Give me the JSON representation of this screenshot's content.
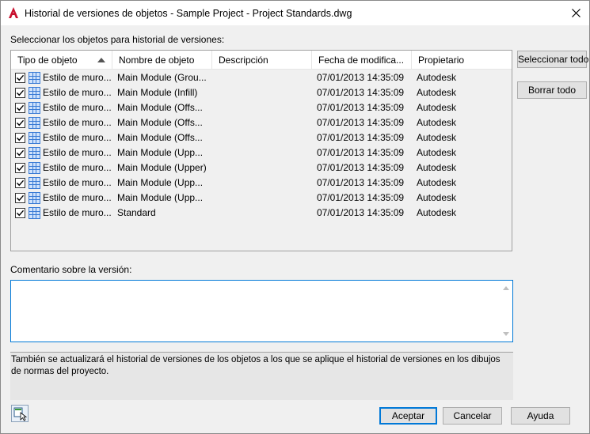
{
  "window": {
    "title": "Historial de versiones de objetos - Sample Project - Project Standards.dwg",
    "close_glyph": "✕"
  },
  "select_label": "Seleccionar los objetos para historial de versiones:",
  "columns": [
    "Tipo de objeto",
    "Nombre de objeto",
    "Descripción",
    "Fecha de modifica...",
    "Propietario"
  ],
  "rows": [
    {
      "checked": true,
      "type": "Estilo de muro...",
      "name": "Main Module (Grou...",
      "description": "",
      "date": "07/01/2013 14:35:09",
      "owner": "Autodesk"
    },
    {
      "checked": true,
      "type": "Estilo de muro...",
      "name": "Main Module (Infill)",
      "description": "",
      "date": "07/01/2013 14:35:09",
      "owner": "Autodesk"
    },
    {
      "checked": true,
      "type": "Estilo de muro...",
      "name": "Main Module (Offs...",
      "description": "",
      "date": "07/01/2013 14:35:09",
      "owner": "Autodesk"
    },
    {
      "checked": true,
      "type": "Estilo de muro...",
      "name": "Main Module (Offs...",
      "description": "",
      "date": "07/01/2013 14:35:09",
      "owner": "Autodesk"
    },
    {
      "checked": true,
      "type": "Estilo de muro...",
      "name": "Main Module (Offs...",
      "description": "",
      "date": "07/01/2013 14:35:09",
      "owner": "Autodesk"
    },
    {
      "checked": true,
      "type": "Estilo de muro...",
      "name": "Main Module (Upp...",
      "description": "",
      "date": "07/01/2013 14:35:09",
      "owner": "Autodesk"
    },
    {
      "checked": true,
      "type": "Estilo de muro...",
      "name": "Main Module (Upper)",
      "description": "",
      "date": "07/01/2013 14:35:09",
      "owner": "Autodesk"
    },
    {
      "checked": true,
      "type": "Estilo de muro...",
      "name": "Main Module (Upp...",
      "description": "",
      "date": "07/01/2013 14:35:09",
      "owner": "Autodesk"
    },
    {
      "checked": true,
      "type": "Estilo de muro...",
      "name": "Main Module (Upp...",
      "description": "",
      "date": "07/01/2013 14:35:09",
      "owner": "Autodesk"
    },
    {
      "checked": true,
      "type": "Estilo de muro...",
      "name": "Standard",
      "description": "",
      "date": "07/01/2013 14:35:09",
      "owner": "Autodesk"
    }
  ],
  "buttons": {
    "select_all": "Seleccionar todo",
    "clear_all": "Borrar todo",
    "accept": "Aceptar",
    "cancel": "Cancelar",
    "help": "Ayuda"
  },
  "comment_label": "Comentario sobre la versión:",
  "comment_value": "",
  "info_text": "También se actualizará el historial de versiones de los objetos a los que se aplique el historial de versiones en los dibujos de normas del proyecto.",
  "icons": {
    "app": "autocad-logo-icon",
    "object": "wall-style-icon",
    "utility": "tool-select-icon"
  },
  "colors": {
    "accent": "#0078d7",
    "app_icon_red": "#c8102e",
    "object_icon_blue": "#3a7bd5"
  }
}
